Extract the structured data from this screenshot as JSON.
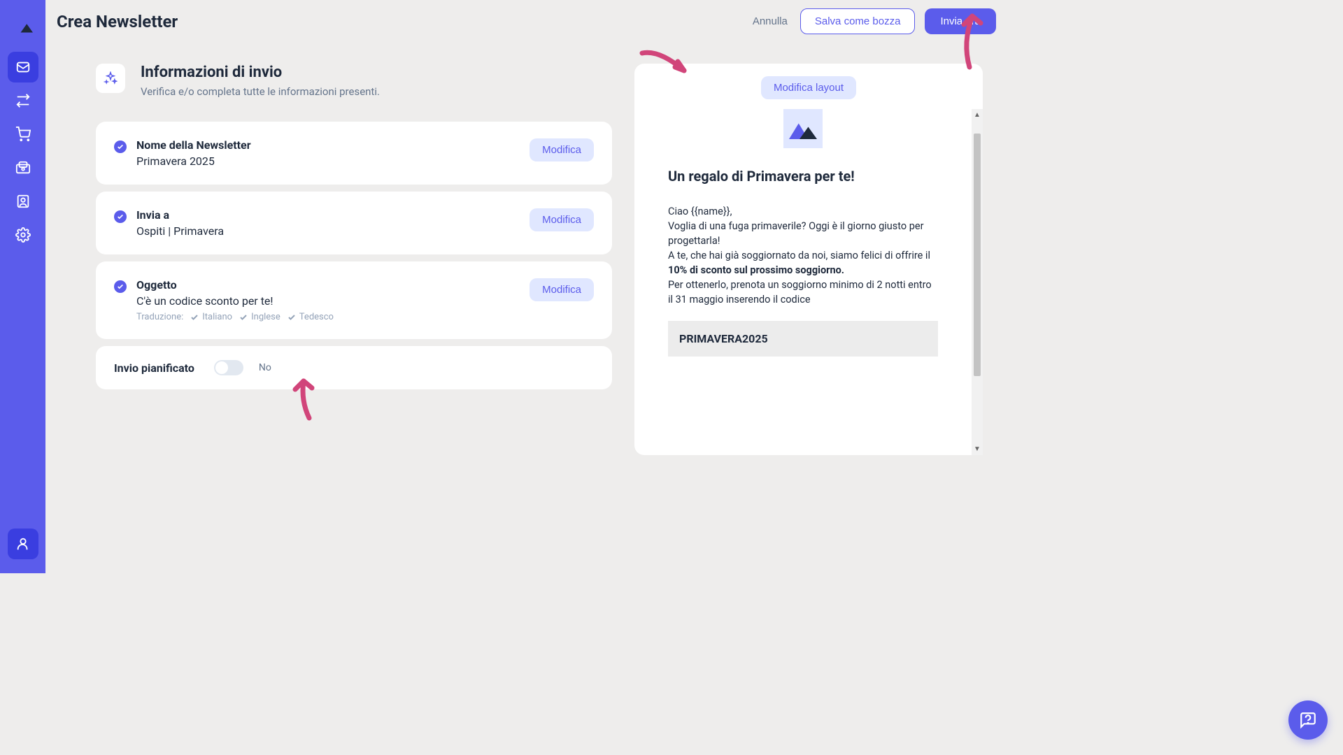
{
  "page_title": "Crea Newsletter",
  "actions": {
    "cancel": "Annulla",
    "save_draft": "Salva come bozza",
    "send_now": "Invia ora"
  },
  "section": {
    "title": "Informazioni di invio",
    "subtitle": "Verifica e/o completa tutte le informazioni presenti."
  },
  "edit_label": "Modifica",
  "cards": {
    "name": {
      "label": "Nome della Newsletter",
      "value": "Primavera 2025"
    },
    "recipients": {
      "label": "Invia a",
      "value": "Ospiti | Primavera"
    },
    "subject": {
      "label": "Oggetto",
      "value": "C'è un codice sconto per te!",
      "translations_label": "Traduzione:",
      "langs": [
        "Italiano",
        "Inglese",
        "Tedesco"
      ]
    }
  },
  "schedule": {
    "label": "Invio pianificato",
    "state": "No"
  },
  "preview": {
    "edit_layout": "Modifica layout",
    "headline": "Un regalo di Primavera per te!",
    "greeting": "Ciao {{name}},",
    "line1": "Voglia di una fuga primaverile? Oggi è il giorno giusto per progettarla!",
    "line2_a": "A te, che hai già soggiornato da noi, siamo felici di offrire il ",
    "line2_bold": "10% di sconto sul prossimo soggiorno.",
    "line3": "Per ottenerlo, prenota un soggiorno minimo di 2 notti entro il 31 maggio inserendo il codice",
    "code": "PRIMAVERA2025"
  }
}
